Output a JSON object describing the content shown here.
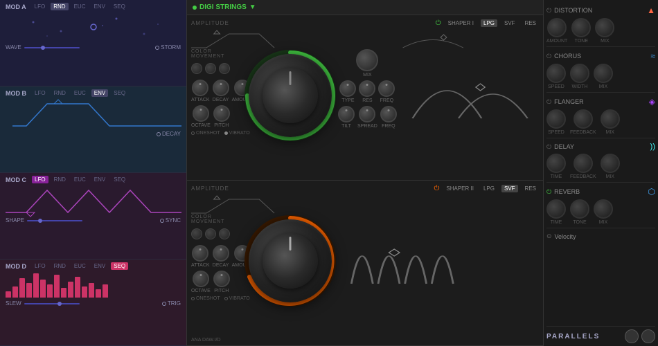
{
  "app": {
    "preset_name": "DIGI STRINGS",
    "parallels_label": "PARALLELS"
  },
  "left_panel": {
    "mods": [
      {
        "id": "mod-a",
        "label": "MOD A",
        "tabs": [
          "LFO",
          "RND",
          "EUC",
          "ENV",
          "SEQ"
        ],
        "active_tab": "RND",
        "bottom_left": "WAVE",
        "bottom_right": "STORM",
        "color": "#4444aa",
        "wave_color": "#6666cc",
        "bg": "#1e1e3a"
      },
      {
        "id": "mod-b",
        "label": "MOD B",
        "tabs": [
          "LFO",
          "RND",
          "EUC",
          "ENV",
          "SEQ"
        ],
        "active_tab": "ENV",
        "bottom_left": "",
        "bottom_right": "DECAY",
        "color": "#2255aa",
        "wave_color": "#3377cc",
        "bg": "#1a2233"
      },
      {
        "id": "mod-c",
        "label": "MOD C",
        "tabs": [
          "LFO",
          "RND",
          "EUC",
          "ENV",
          "SEQ"
        ],
        "active_tab": "LFO",
        "bottom_left": "SHAPE",
        "bottom_right": "SYNC",
        "color": "#882299",
        "wave_color": "#aa44bb",
        "bg": "#221a2e"
      },
      {
        "id": "mod-d",
        "label": "MOD D",
        "tabs": [
          "LFO",
          "RND",
          "EUC",
          "ENV",
          "SEQ"
        ],
        "active_tab": "SEQ",
        "bottom_left": "SLEW",
        "bottom_right": "TRIG",
        "color": "#cc3366",
        "wave_color": "#dd4477",
        "bg": "#2e1a22"
      }
    ]
  },
  "osc1": {
    "color": "#44cc44",
    "shaper_label": "SHAPER I",
    "lpg_label": "LPG",
    "svf_label": "SVF",
    "res_label": "RES",
    "amplitude_label": "AMPLITUDE",
    "color_movement_label": "COLOR MOVEMENT",
    "attack_label": "ATTACK",
    "decay_label": "DECAY",
    "amount_label": "AMOUNT",
    "octave_label": "OCTAVE",
    "pitch_label": "PITCH",
    "oneshot_label": "ONESHOT",
    "vibrato_label": "VIBRATO",
    "mix_label": "MIX",
    "type_label": "TYPE",
    "res2_label": "RES",
    "freq_label": "FREQ",
    "tilt_label": "TILT",
    "spread_label": "SPREAD",
    "freq2_label": "FREQ"
  },
  "osc2": {
    "color": "#ff6600",
    "shaper_label": "SHAPER II",
    "lpg_label": "LPG",
    "svf_label": "SVF",
    "res_label": "RES",
    "amplitude_label": "AMPLITUDE",
    "color_movement_label": "COLOR MOVEMENT",
    "attack_label": "ATTACK",
    "decay_label": "DECAY",
    "amount_label": "AMOUNT",
    "octave_label": "OCTAVE",
    "pitch_label": "PITCH",
    "oneshot_label": "ONESHOT",
    "vibrato_label": "VIBRATO",
    "ana_daw_label": "ANA DAW.I/D"
  },
  "fx": {
    "distortion": {
      "label": "DISTORTION",
      "knobs": [
        "AMOUNT",
        "TONE",
        "MIX"
      ]
    },
    "chorus": {
      "label": "CHORUS",
      "knobs": [
        "SPEED",
        "WIDTH",
        "MIX"
      ]
    },
    "flanger": {
      "label": "FLANGER",
      "knobs": [
        "SPEED",
        "FEEDBACK",
        "MIX"
      ]
    },
    "delay": {
      "label": "DELAY",
      "knobs": [
        "TIME",
        "FEEDBACK",
        "MIX"
      ]
    },
    "reverb": {
      "label": "REVERB",
      "knobs": [
        "TIME",
        "TONE",
        "MIX"
      ]
    },
    "velocity": {
      "label": "Velocity"
    }
  },
  "mod_d_bars": [
    4,
    7,
    12,
    9,
    15,
    11,
    8,
    14,
    6,
    10,
    13,
    7,
    9,
    5,
    8
  ]
}
